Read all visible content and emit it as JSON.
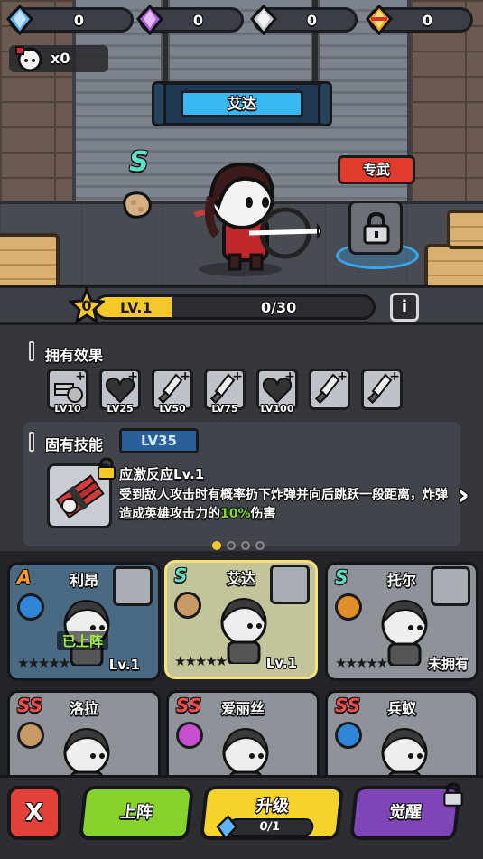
{
  "currencies": [
    {
      "icon": "blue-gem-icon",
      "color": "#5fb4f5",
      "value": "0"
    },
    {
      "icon": "purple-gem-icon",
      "color": "#a85bd8",
      "value": "0"
    },
    {
      "icon": "silver-gem-icon",
      "color": "#c9ccd2",
      "value": "0"
    },
    {
      "icon": "gold-gem-icon",
      "color": "#f3a91c",
      "value": "0"
    }
  ],
  "hero_count": "x0",
  "hero": {
    "name": "艾达",
    "rank": "S",
    "exclusive_weapon_label": "专武"
  },
  "level": {
    "stars": "0",
    "label": "LV.1",
    "progress_text": "0/30",
    "progress_fraction": 0.27,
    "info_label": "i"
  },
  "owned_effects": {
    "title": "拥有效果",
    "items": [
      {
        "label": "LV10",
        "icon": "coins-icon"
      },
      {
        "label": "LV25",
        "icon": "heart-icon"
      },
      {
        "label": "LV50",
        "icon": "sword-icon"
      },
      {
        "label": "LV75",
        "icon": "sword-icon"
      },
      {
        "label": "LV100",
        "icon": "heart-icon"
      },
      {
        "label": "",
        "icon": "sword-icon"
      },
      {
        "label": "",
        "icon": "sword-icon"
      }
    ]
  },
  "innate_skill": {
    "title": "固有技能",
    "unlock_level": "LV35",
    "name": "应激反应Lv.1",
    "desc_a": "受到敌人攻击时有概率扔下炸弹并向后跳跃一段距离，炸弹造成英雄攻击力的",
    "desc_pct": "10%",
    "desc_b": "伤害"
  },
  "heroes": [
    {
      "name": "利昂",
      "rank": "A",
      "level": "Lv.1",
      "status": "已上阵",
      "orb": "#2f86d8",
      "bg": "#4a6a84"
    },
    {
      "name": "艾达",
      "rank": "S",
      "level": "Lv.1",
      "status": "",
      "orb": "#c79a66",
      "bg": "#c3c49a"
    },
    {
      "name": "托尔",
      "rank": "S",
      "level": "",
      "status": "未拥有",
      "orb": "#e0902a",
      "bg": "#8e9299"
    },
    {
      "name": "洛拉",
      "rank": "SS",
      "level": "",
      "status": "",
      "orb": "#c79a66",
      "bg": "#8e9299"
    },
    {
      "name": "爱丽丝",
      "rank": "SS",
      "level": "",
      "status": "",
      "orb": "#c84fd0",
      "bg": "#8e9299"
    },
    {
      "name": "兵蚁",
      "rank": "SS",
      "level": "",
      "status": "",
      "orb": "#2f86d8",
      "bg": "#8e9299"
    }
  ],
  "buttons": {
    "close": "X",
    "deploy": "上阵",
    "upgrade": "升级",
    "upgrade_cost": "0/1",
    "awaken": "觉醒"
  }
}
